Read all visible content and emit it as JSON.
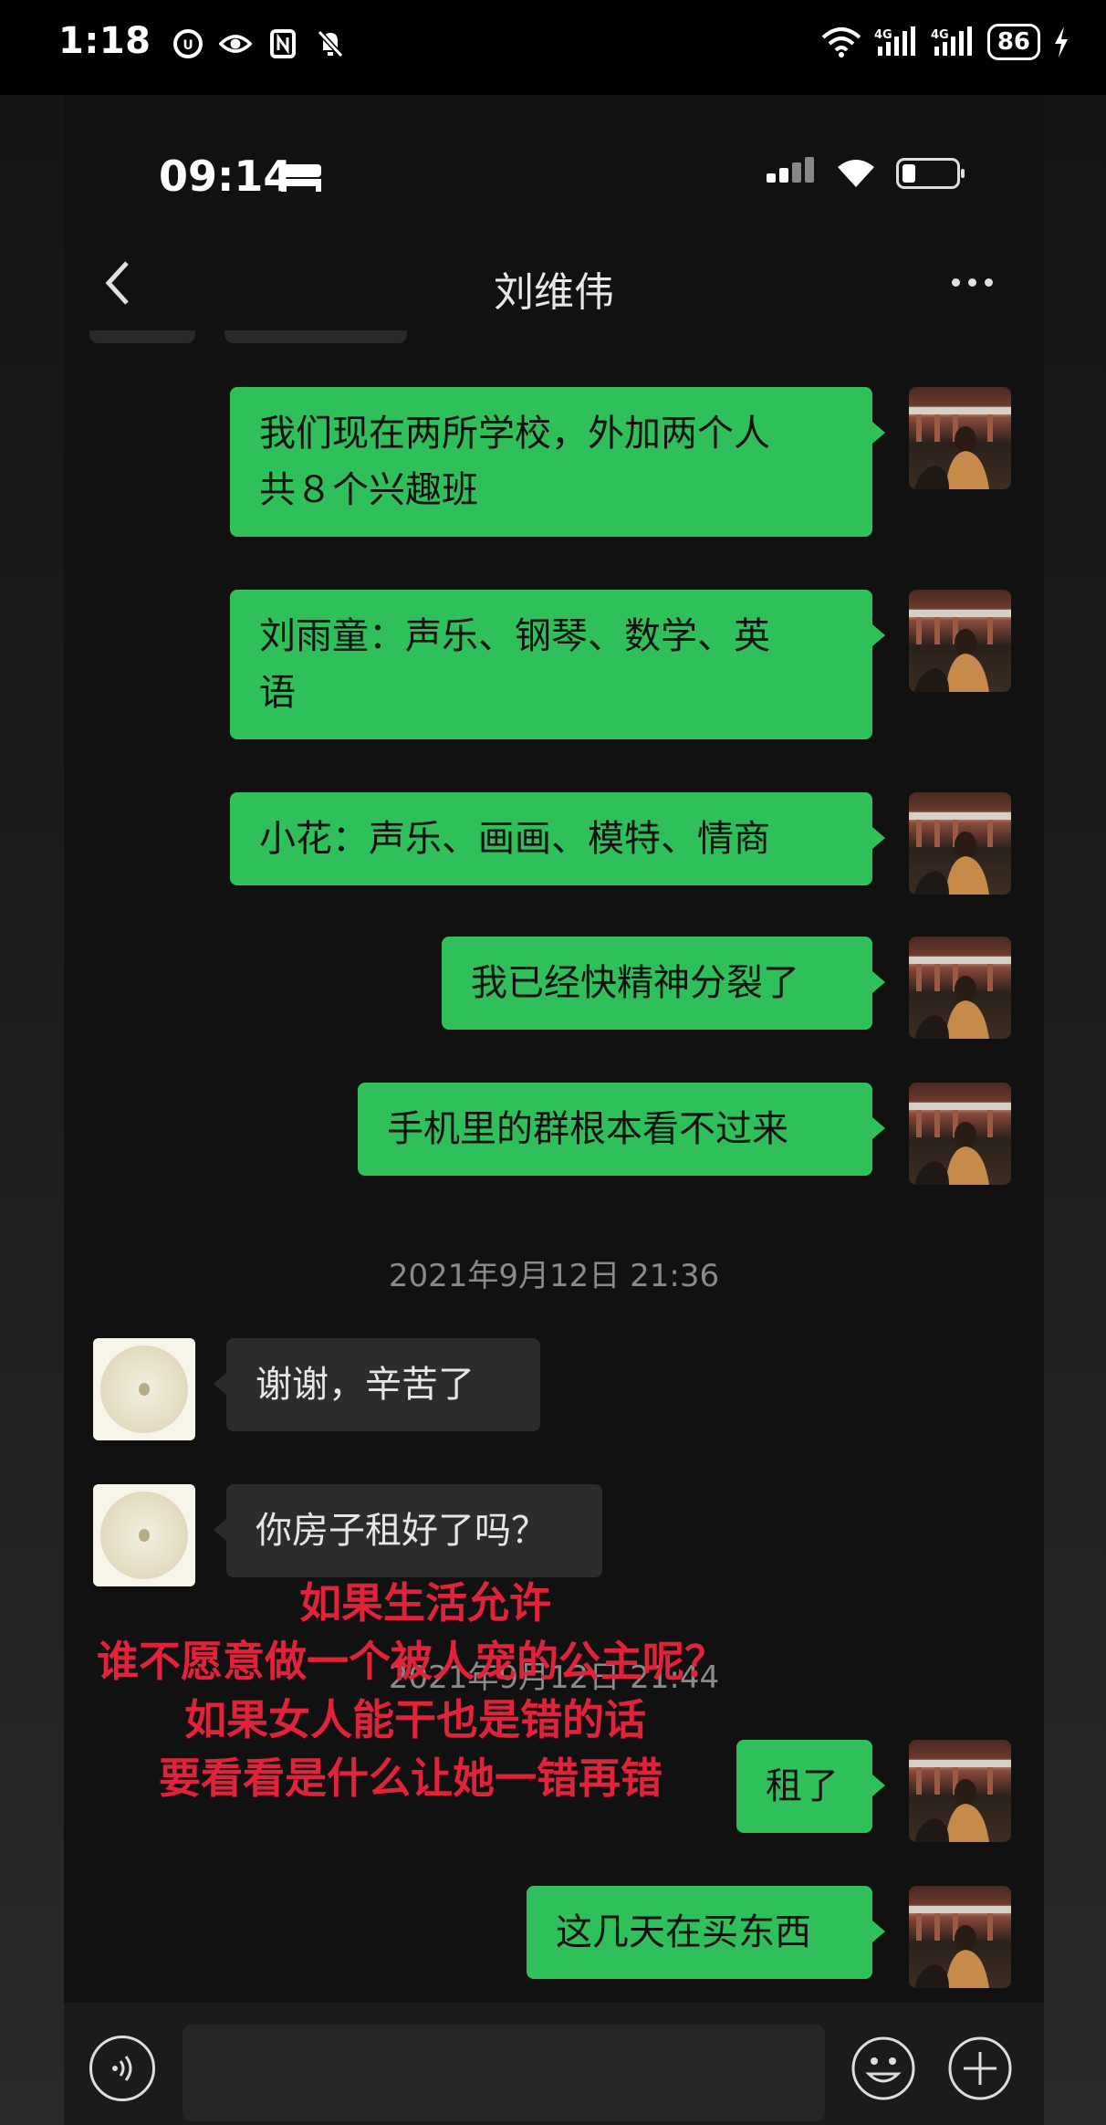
{
  "outer_status": {
    "time": "1:18",
    "battery": "86"
  },
  "inner_status": {
    "time": "09:14"
  },
  "header": {
    "title": "刘维伟"
  },
  "messages": [
    {
      "side": "out",
      "lines": [
        "我们现在两所学校，外加两个人",
        "共８个兴趣班"
      ]
    },
    {
      "side": "out",
      "lines": [
        "刘雨童：声乐、钢琴、数学、英",
        "语"
      ]
    },
    {
      "side": "out",
      "lines": [
        "小花：声乐、画画、模特、情商"
      ]
    },
    {
      "side": "out",
      "lines": [
        "我已经快精神分裂了"
      ]
    },
    {
      "side": "out",
      "lines": [
        "手机里的群根本看不过来"
      ]
    },
    {
      "side": "in",
      "lines": [
        "谢谢，辛苦了"
      ]
    },
    {
      "side": "in",
      "lines": [
        "你房子租好了吗？"
      ]
    },
    {
      "side": "out",
      "lines": [
        "租了"
      ]
    },
    {
      "side": "out",
      "lines": [
        "这几天在买东西"
      ]
    }
  ],
  "timestamps": [
    "2021年9月12日 21:36",
    "2021年9月12日 21:44"
  ],
  "overlay_caption": [
    "如果生活允许",
    "谁不愿意做一个被人宠的公主呢？",
    "如果女人能干也是错的话",
    "要看看是什么让她一错再错"
  ],
  "colors": {
    "bubble_out": "#2fbf5b",
    "bubble_in": "#2c2c2c",
    "caption": "#e0223a"
  }
}
